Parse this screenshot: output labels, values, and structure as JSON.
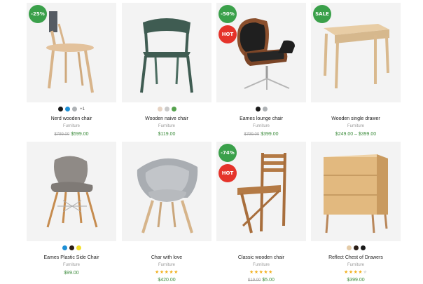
{
  "colors": {
    "green": "#3aa04a",
    "red": "#e5332a",
    "price": "#3e8d3e"
  },
  "products": [
    {
      "name": "Nerd wooden chair",
      "category": "Furniture",
      "old_price": "$799.00",
      "price": "$599.00",
      "badges": [
        "-25%"
      ],
      "swatches": [
        "#1a1a1a",
        "#1e90d6",
        "#aeb2b5"
      ],
      "swatches_more": "+1",
      "icon": "wooden-chair-image"
    },
    {
      "name": "Wooden naive chair",
      "category": "Furniture",
      "price": "$119.00",
      "badges": [],
      "swatches": [
        "#e6d3c3",
        "#c9c9c9",
        "#56a24e"
      ],
      "icon": "green-chair-image"
    },
    {
      "name": "Eames lounge chair",
      "category": "Furniture",
      "old_price": "$799.00",
      "price": "$399.00",
      "badges": [
        "-50%",
        "HOT"
      ],
      "swatches": [
        "#1a1a1a",
        "#aeb2b5"
      ],
      "icon": "lounge-chair-image"
    },
    {
      "name": "Wooden single drawer",
      "category": "Furniture",
      "price": "$249.00 – $399.00",
      "badges": [
        "SALE"
      ],
      "swatches": [],
      "icon": "wooden-desk-image"
    },
    {
      "name": "Eames Plastic Side Chair",
      "category": "Furniture",
      "price": "$99.00",
      "badges": [],
      "swatches": [
        "#1e90d6",
        "#2b1e16",
        "#f4e02a"
      ],
      "icon": "plastic-chair-image"
    },
    {
      "name": "Char with love",
      "category": "Furniture",
      "price": "$420.00",
      "rating": 5,
      "badges": [],
      "swatches": [],
      "icon": "armchair-image"
    },
    {
      "name": "Classic wooden chair",
      "category": "Furniture",
      "old_price": "$19.00",
      "price": "$5.00",
      "rating": 5,
      "badges": [
        "-74%",
        "HOT"
      ],
      "swatches": [],
      "icon": "folding-chair-image"
    },
    {
      "name": "Reflect Chest of Drawers",
      "category": "Furniture",
      "price": "$399.00",
      "rating": 4,
      "badges": [],
      "swatches": [
        "#e4cba7",
        "#2b1e16",
        "#1a1a1a"
      ],
      "icon": "chest-of-drawers-image"
    }
  ]
}
